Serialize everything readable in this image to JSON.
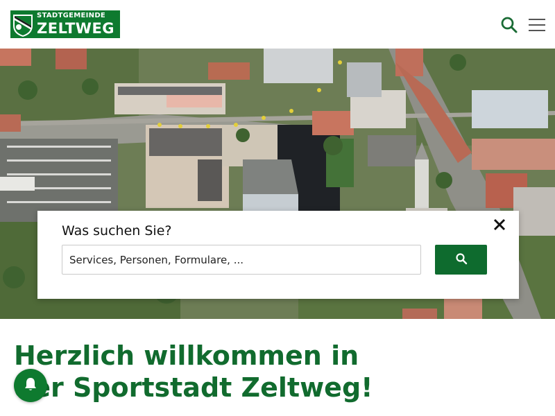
{
  "header": {
    "logo": {
      "line1": "STADTGEMEINDE",
      "line2": "ZELTWEG",
      "crest_icon": "shield-crest-icon"
    },
    "search_icon": "search-icon",
    "menu_icon": "hamburger-menu-icon"
  },
  "search": {
    "heading": "Was suchen Sie?",
    "placeholder": "Services, Personen, Formulare, ...",
    "value": "",
    "close_icon": "close-icon",
    "submit_icon": "search-icon"
  },
  "main": {
    "welcome_title": "Herzlich willkommen in der Sportstadt Zeltweg!"
  },
  "notifications": {
    "icon": "bell-icon"
  },
  "colors": {
    "brand_green": "#0e7a2f",
    "button_green": "#0e6b2e",
    "title_green": "#116b2e"
  }
}
